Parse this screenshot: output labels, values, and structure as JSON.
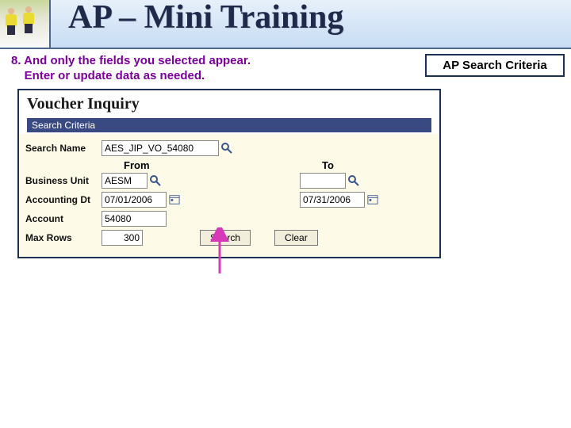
{
  "slide": {
    "title": "AP – Mini Training",
    "badge": "AP Search Criteria",
    "instruction_line1": "8. And only the fields you selected appear.",
    "instruction_line2": "Enter or update data as needed."
  },
  "app": {
    "page_heading": "Voucher Inquiry",
    "section_title": "Search Criteria",
    "columns": {
      "from": "From",
      "to": "To"
    },
    "labels": {
      "search_name": "Search Name",
      "business_unit": "Business Unit",
      "accounting_dt": "Accounting Dt",
      "account": "Account",
      "max_rows": "Max Rows"
    },
    "values": {
      "search_name": "AES_JIP_VO_54080",
      "bu_from": "AESM",
      "bu_to": "",
      "dt_from": "07/01/2006",
      "dt_to": "07/31/2006",
      "account": "54080",
      "max_rows": "300"
    },
    "buttons": {
      "search": "Search",
      "clear": "Clear"
    }
  }
}
